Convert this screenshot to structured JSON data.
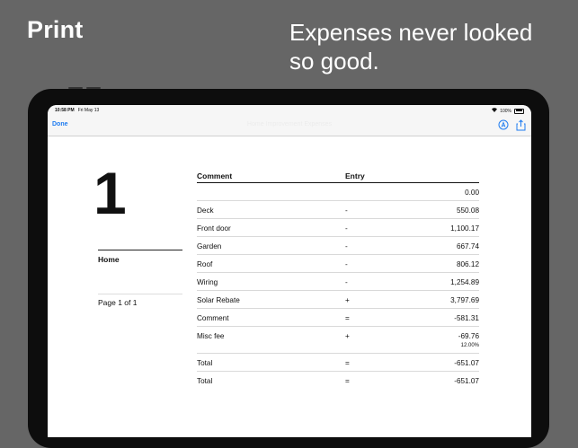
{
  "hero": {
    "left_title": "Print",
    "right_line1": "Expenses never looked",
    "right_line2": "so good."
  },
  "status_bar": {
    "time": "10:58 PM",
    "date": "Fri May 13",
    "battery": "100%"
  },
  "nav": {
    "done_label": "Done",
    "title": "Home Improvement Expenses"
  },
  "document": {
    "big_number": "1",
    "section_label": "Home",
    "page_label": "Page 1 of 1",
    "columns": [
      "Comment",
      "Entry"
    ],
    "rows": [
      {
        "comment": "",
        "op": "",
        "value": "0.00",
        "sub": ""
      },
      {
        "comment": "Deck",
        "op": "-",
        "value": "550.08",
        "sub": ""
      },
      {
        "comment": "Front door",
        "op": "-",
        "value": "1,100.17",
        "sub": ""
      },
      {
        "comment": "Garden",
        "op": "-",
        "value": "667.74",
        "sub": ""
      },
      {
        "comment": "Roof",
        "op": "-",
        "value": "806.12",
        "sub": ""
      },
      {
        "comment": "Wiring",
        "op": "-",
        "value": "1,254.89",
        "sub": ""
      },
      {
        "comment": "Solar Rebate",
        "op": "+",
        "value": "3,797.69",
        "sub": ""
      },
      {
        "comment": "Comment",
        "op": "=",
        "value": "-581.31",
        "sub": ""
      },
      {
        "comment": "Misc fee",
        "op": "+",
        "value": "-69.76",
        "sub": "12.00%"
      },
      {
        "comment": "Total",
        "op": "=",
        "value": "-651.07",
        "sub": ""
      },
      {
        "comment": "Total",
        "op": "=",
        "value": "-651.07",
        "sub": ""
      }
    ]
  },
  "icons": {
    "nav_right": [
      "markup-icon",
      "share-icon"
    ],
    "status": [
      "wifi-icon",
      "battery-icon"
    ]
  },
  "colors": {
    "background": "#666666",
    "accent": "#1f7cf0"
  }
}
